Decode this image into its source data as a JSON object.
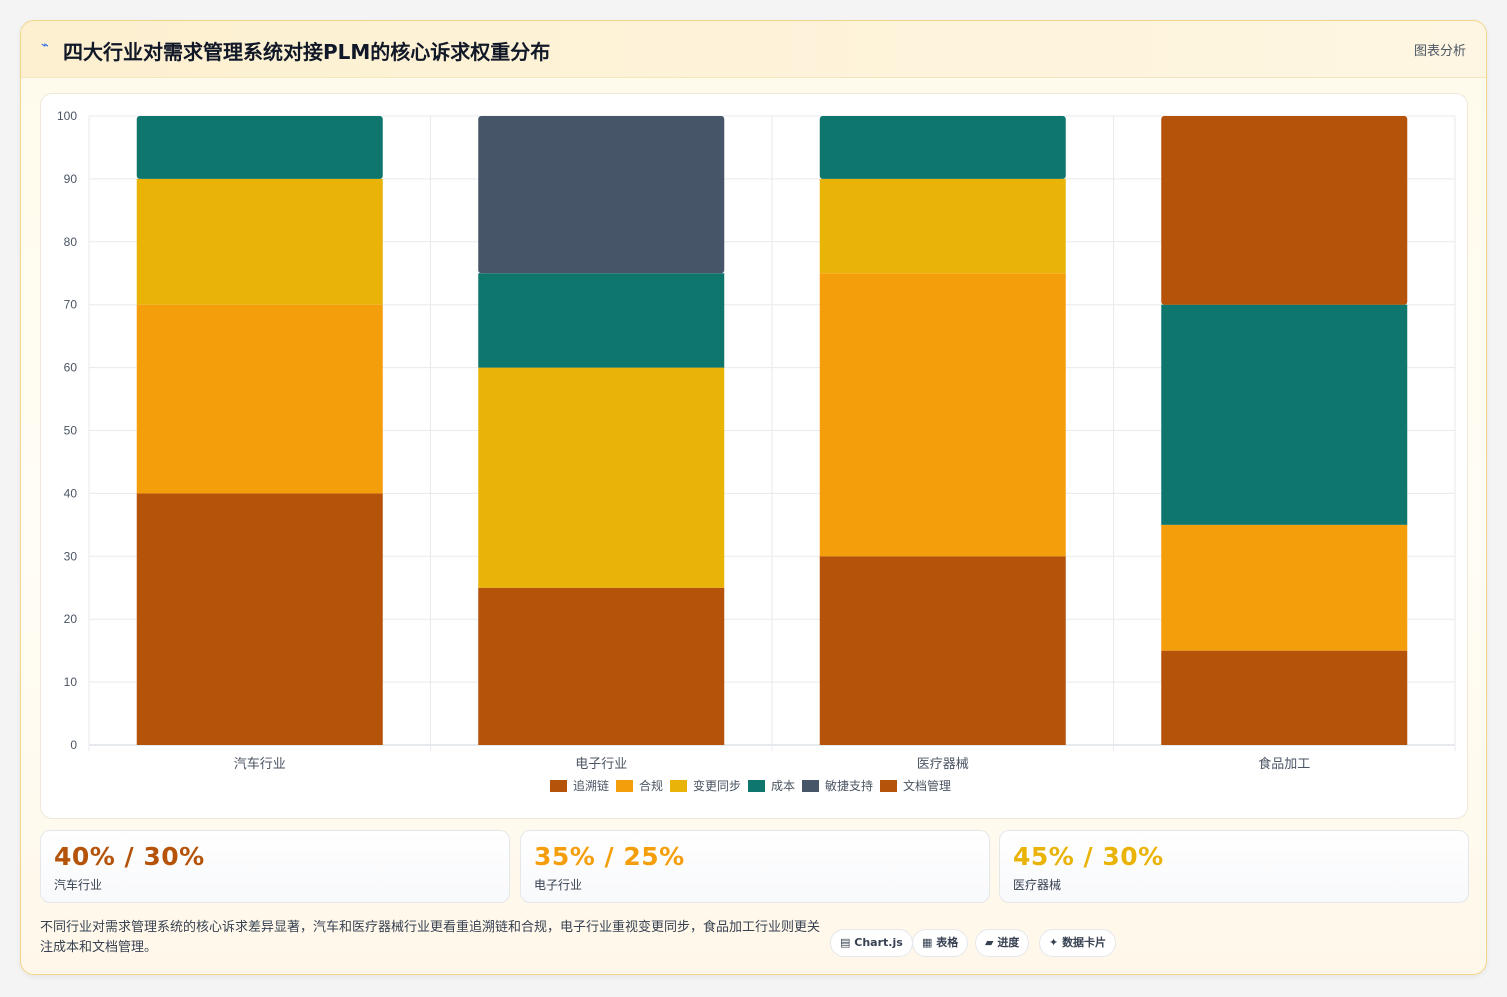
{
  "header": {
    "title": "四大行业对需求管理系统对接PLM的核心诉求权重分布",
    "tag": "图表分析"
  },
  "chart_data": {
    "type": "bar",
    "stacked": true,
    "categories": [
      "汽车行业",
      "电子行业",
      "医疗器械",
      "食品加工"
    ],
    "ylim": [
      0,
      100
    ],
    "yticks": [
      0,
      10,
      20,
      30,
      40,
      50,
      60,
      70,
      80,
      90,
      100
    ],
    "grid": true,
    "legend_position": "bottom",
    "series": [
      {
        "name": "追溯链",
        "color": "#b45309",
        "values": [
          40,
          25,
          30,
          15
        ]
      },
      {
        "name": "合规",
        "color": "#f59e0b",
        "values": [
          30,
          0,
          45,
          20
        ]
      },
      {
        "name": "变更同步",
        "color": "#eab308",
        "values": [
          20,
          35,
          15,
          0
        ]
      },
      {
        "name": "成本",
        "color": "#0f766e",
        "values": [
          10,
          15,
          10,
          35
        ]
      },
      {
        "name": "敏捷支持",
        "color": "#475569",
        "values": [
          0,
          25,
          0,
          0
        ]
      },
      {
        "name": "文档管理",
        "color": "#b45309",
        "values": [
          0,
          0,
          0,
          30
        ]
      }
    ]
  },
  "stats": [
    {
      "value": "40% / 30%",
      "label": "汽车行业",
      "color": "#b45309"
    },
    {
      "value": "35% / 25%",
      "label": "电子行业",
      "color": "#f59e0b"
    },
    {
      "value": "45% / 30%",
      "label": "医疗器械",
      "color": "#eab308"
    }
  ],
  "note": "不同行业对需求管理系统的核心诉求差异显著，汽车和医疗器械行业更看重追溯链和合规，电子行业重视变更同步，食品加工行业则更关注成本和文档管理。",
  "chips": [
    {
      "icon": "▤",
      "label": "Chart.js"
    },
    {
      "icon": "▦",
      "label": "表格"
    },
    {
      "icon": "▰",
      "label": "进度"
    },
    {
      "icon": "✦",
      "label": "数据卡片"
    }
  ]
}
